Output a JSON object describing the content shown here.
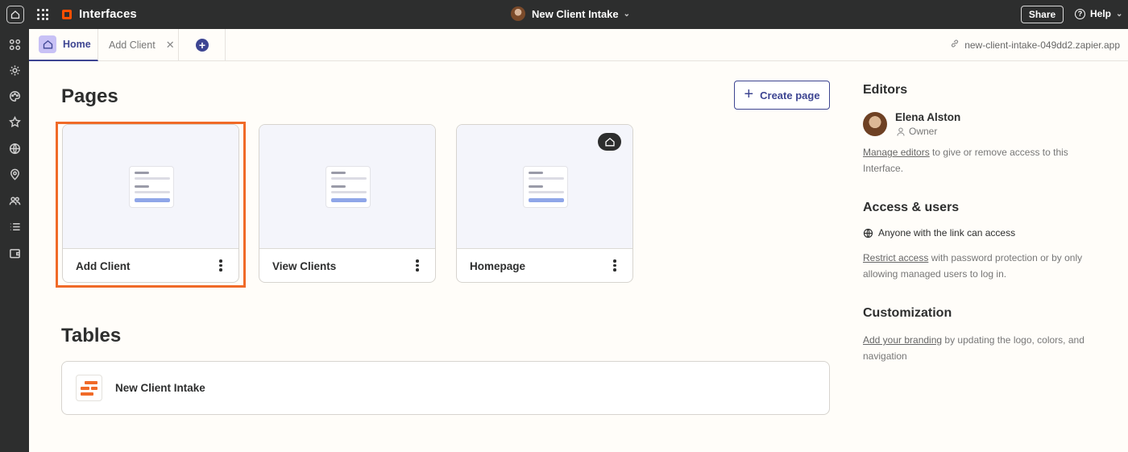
{
  "topbar": {
    "brand": "Interfaces",
    "project_title": "New Client Intake",
    "share_label": "Share",
    "help_label": "Help"
  },
  "tabs": [
    {
      "label": "Home",
      "active": true
    },
    {
      "label": "Add Client",
      "active": false
    }
  ],
  "url": "new-client-intake-049dd2.zapier.app",
  "pages": {
    "heading": "Pages",
    "create_label": "Create page",
    "cards": [
      {
        "label": "Add Client",
        "highlighted": true,
        "is_home": false
      },
      {
        "label": "View Clients",
        "highlighted": false,
        "is_home": false
      },
      {
        "label": "Homepage",
        "highlighted": false,
        "is_home": true
      }
    ]
  },
  "tables": {
    "heading": "Tables",
    "items": [
      {
        "label": "New Client Intake"
      }
    ]
  },
  "side": {
    "editors": {
      "heading": "Editors",
      "name": "Elena Alston",
      "role": "Owner",
      "link": "Manage editors",
      "text": " to give or remove access to this Interface."
    },
    "access": {
      "heading": "Access & users",
      "status": "Anyone with the link can access",
      "link": "Restrict access",
      "text": " with password protection or by only allowing managed users to log in."
    },
    "customization": {
      "heading": "Customization",
      "link": "Add your branding",
      "text": " by updating the logo, colors, and navigation"
    }
  },
  "colors": {
    "accent": "#3d4592",
    "brand": "#ff4f00",
    "highlight": "#f06a28"
  }
}
